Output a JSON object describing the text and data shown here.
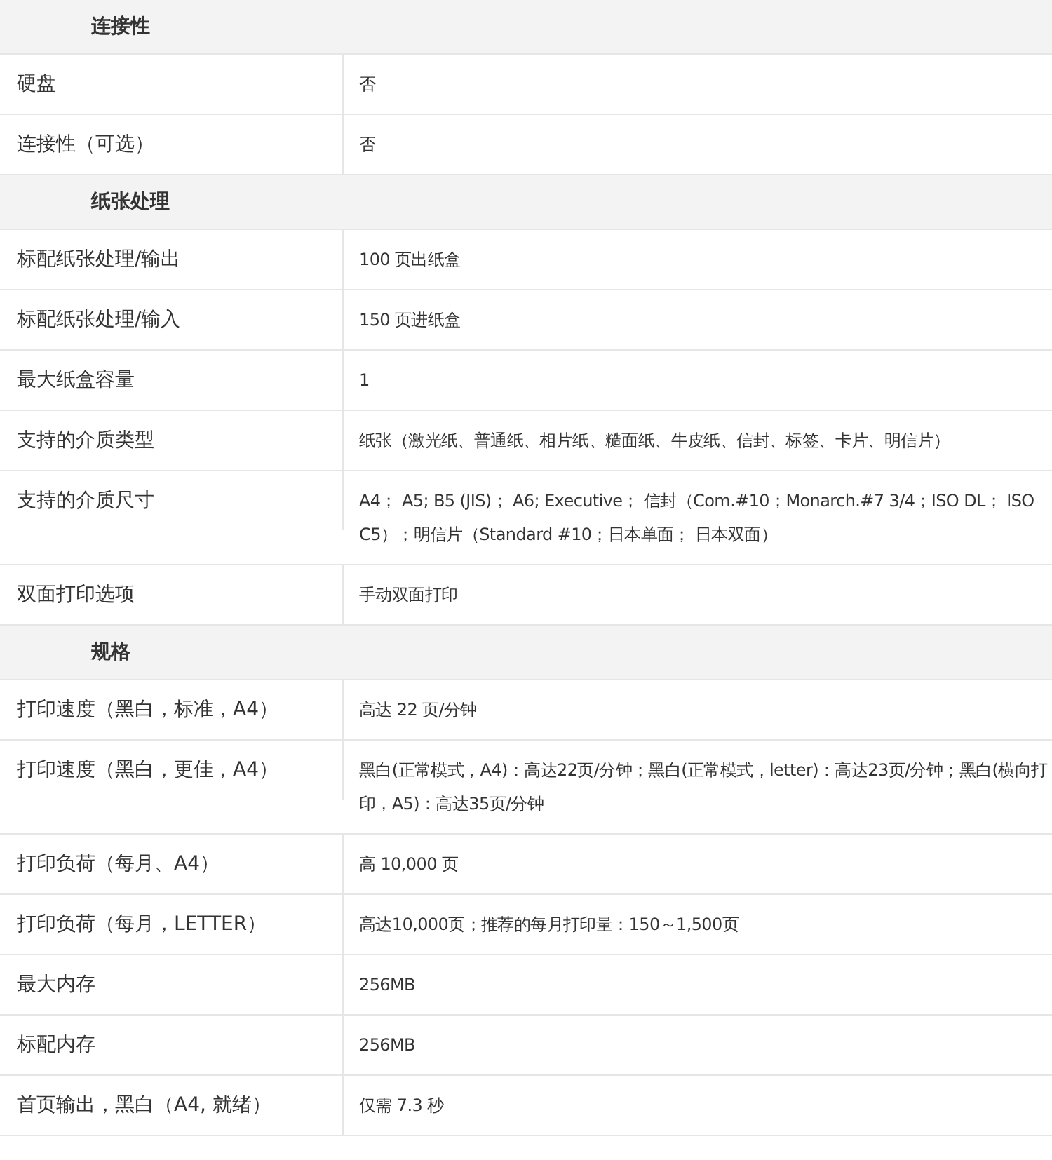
{
  "sections": [
    {
      "title": "连接性",
      "rows": [
        {
          "label": "硬盘",
          "value": "否"
        },
        {
          "label": "连接性（可选）",
          "value": "否"
        }
      ]
    },
    {
      "title": "纸张处理",
      "rows": [
        {
          "label": "标配纸张处理/输出",
          "value": "100 页出纸盒"
        },
        {
          "label": "标配纸张处理/输入",
          "value": "150 页进纸盒"
        },
        {
          "label": "最大纸盒容量",
          "value": "1"
        },
        {
          "label": "支持的介质类型",
          "value": "纸张（激光纸、普通纸、相片纸、糙面纸、牛皮纸、信封、标签、卡片、明信片）"
        },
        {
          "label": "支持的介质尺寸",
          "value": "A4； A5; B5 (JIS)； A6; Executive； 信封（Com.#10；Monarch.#7 3/4；ISO DL； ISO C5）；明信片（Standard #10；日本单面； 日本双面）"
        },
        {
          "label": "双面打印选项",
          "value": "手动双面打印"
        }
      ]
    },
    {
      "title": "规格",
      "rows": [
        {
          "label": "打印速度（黑白，标准，A4）",
          "value": "高达 22 页/分钟"
        },
        {
          "label": "打印速度（黑白，更佳，A4）",
          "value": "黑白(正常模式，A4)：高达22页/分钟；黑白(正常模式，letter)：高达23页/分钟；黑白(横向打印，A5)：高达35页/分钟"
        },
        {
          "label": "打印负荷（每月、A4）",
          "value": "高 10,000 页"
        },
        {
          "label": "打印负荷（每月，LETTER）",
          "value": "高达10,000页；推荐的每月打印量：150～1,500页"
        },
        {
          "label": "最大内存",
          "value": "256MB"
        },
        {
          "label": "标配内存",
          "value": "256MB"
        },
        {
          "label": "首页输出，黑白（A4, 就绪）",
          "value": "仅需 7.3 秒"
        }
      ]
    }
  ]
}
